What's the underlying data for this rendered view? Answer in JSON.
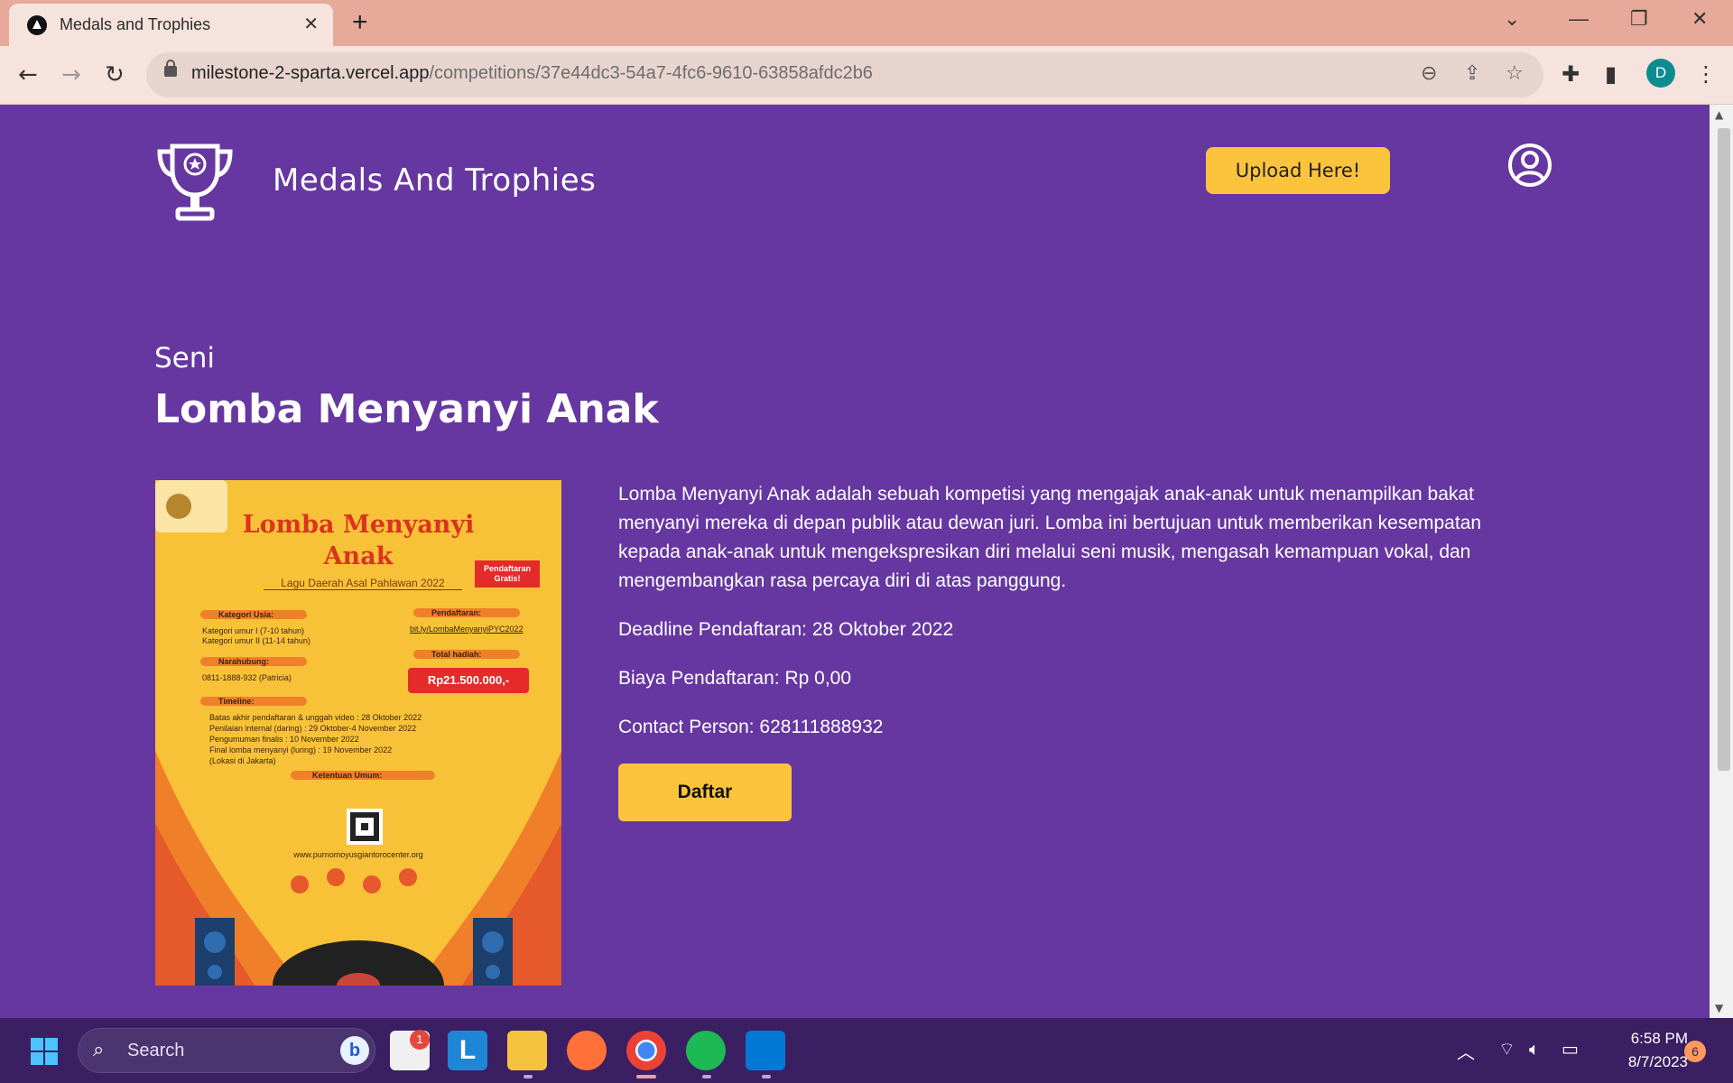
{
  "browser": {
    "tab_title": "Medals and Trophies",
    "url_domain": "milestone-2-sparta.vercel.app",
    "url_path": "/competitions/37e44dc3-54a7-4fc6-9610-63858afdc2b6",
    "profile_initial": "D"
  },
  "header": {
    "brand": "Medals And Trophies",
    "upload_label": "Upload Here!"
  },
  "competition": {
    "category": "Seni",
    "title": "Lomba Menyanyi Anak",
    "description": "Lomba Menyanyi Anak adalah sebuah kompetisi yang mengajak anak-anak untuk menampilkan bakat menyanyi mereka di depan publik atau dewan juri. Lomba ini bertujuan untuk memberikan kesempatan kepada anak-anak untuk mengekspresikan diri melalui seni musik, mengasah kemampuan vokal, dan mengembangkan rasa percaya diri di atas panggung.",
    "deadline": "Deadline Pendaftaran: 28 Oktober 2022",
    "fee": "Biaya Pendaftaran: Rp 0,00",
    "contact": "Contact Person: 628111888932",
    "register_label": "Daftar"
  },
  "poster": {
    "title_line1": "Lomba Menyanyi",
    "title_line2": "Anak",
    "subtitle": "Lagu Daerah Asal Pahlawan 2022",
    "free_badge": "Pendaftaran Gratis!",
    "kategori_heading": "Kategori Usia:",
    "kategori_1": "Kategori umur I (7-10 tahun)",
    "kategori_2": "Kategori umur II (11-14 tahun)",
    "pendaftaran_heading": "Pendaftaran:",
    "pendaftaran_link": "bit.ly/LombaMenyanyiPYC2022",
    "narahubung_heading": "Narahubung:",
    "narahubung_value": "0811-1888-932 (Patricia)",
    "hadiah_heading": "Total hadiah:",
    "hadiah_value": "Rp21.500.000,-",
    "timeline_heading": "Timeline:",
    "timeline_1": "Batas akhir pendaftaran & unggah video : 28 Oktober 2022",
    "timeline_2": "Penilaian internal (daring) : 29 Oktober-4 November 2022",
    "timeline_3": "Pengumuman finalis : 10 November 2022",
    "timeline_4": "Final lomba menyanyi (luring) : 19 November 2022",
    "timeline_5": "(Lokasi di Jakarta)",
    "ketentuan_heading": "Ketentuan Umum:",
    "website": "www.purnomoyusgiantorocenter.org"
  },
  "taskbar": {
    "search_placeholder": "Search",
    "time": "6:58 PM",
    "date": "8/7/2023",
    "notification_count": "6",
    "store_badge": "1"
  },
  "colors": {
    "page_bg": "#6637a1",
    "accent_yellow": "#fcc33d",
    "tabbar_bg": "#e7a999",
    "taskbar_bg": "#3a1f63"
  }
}
